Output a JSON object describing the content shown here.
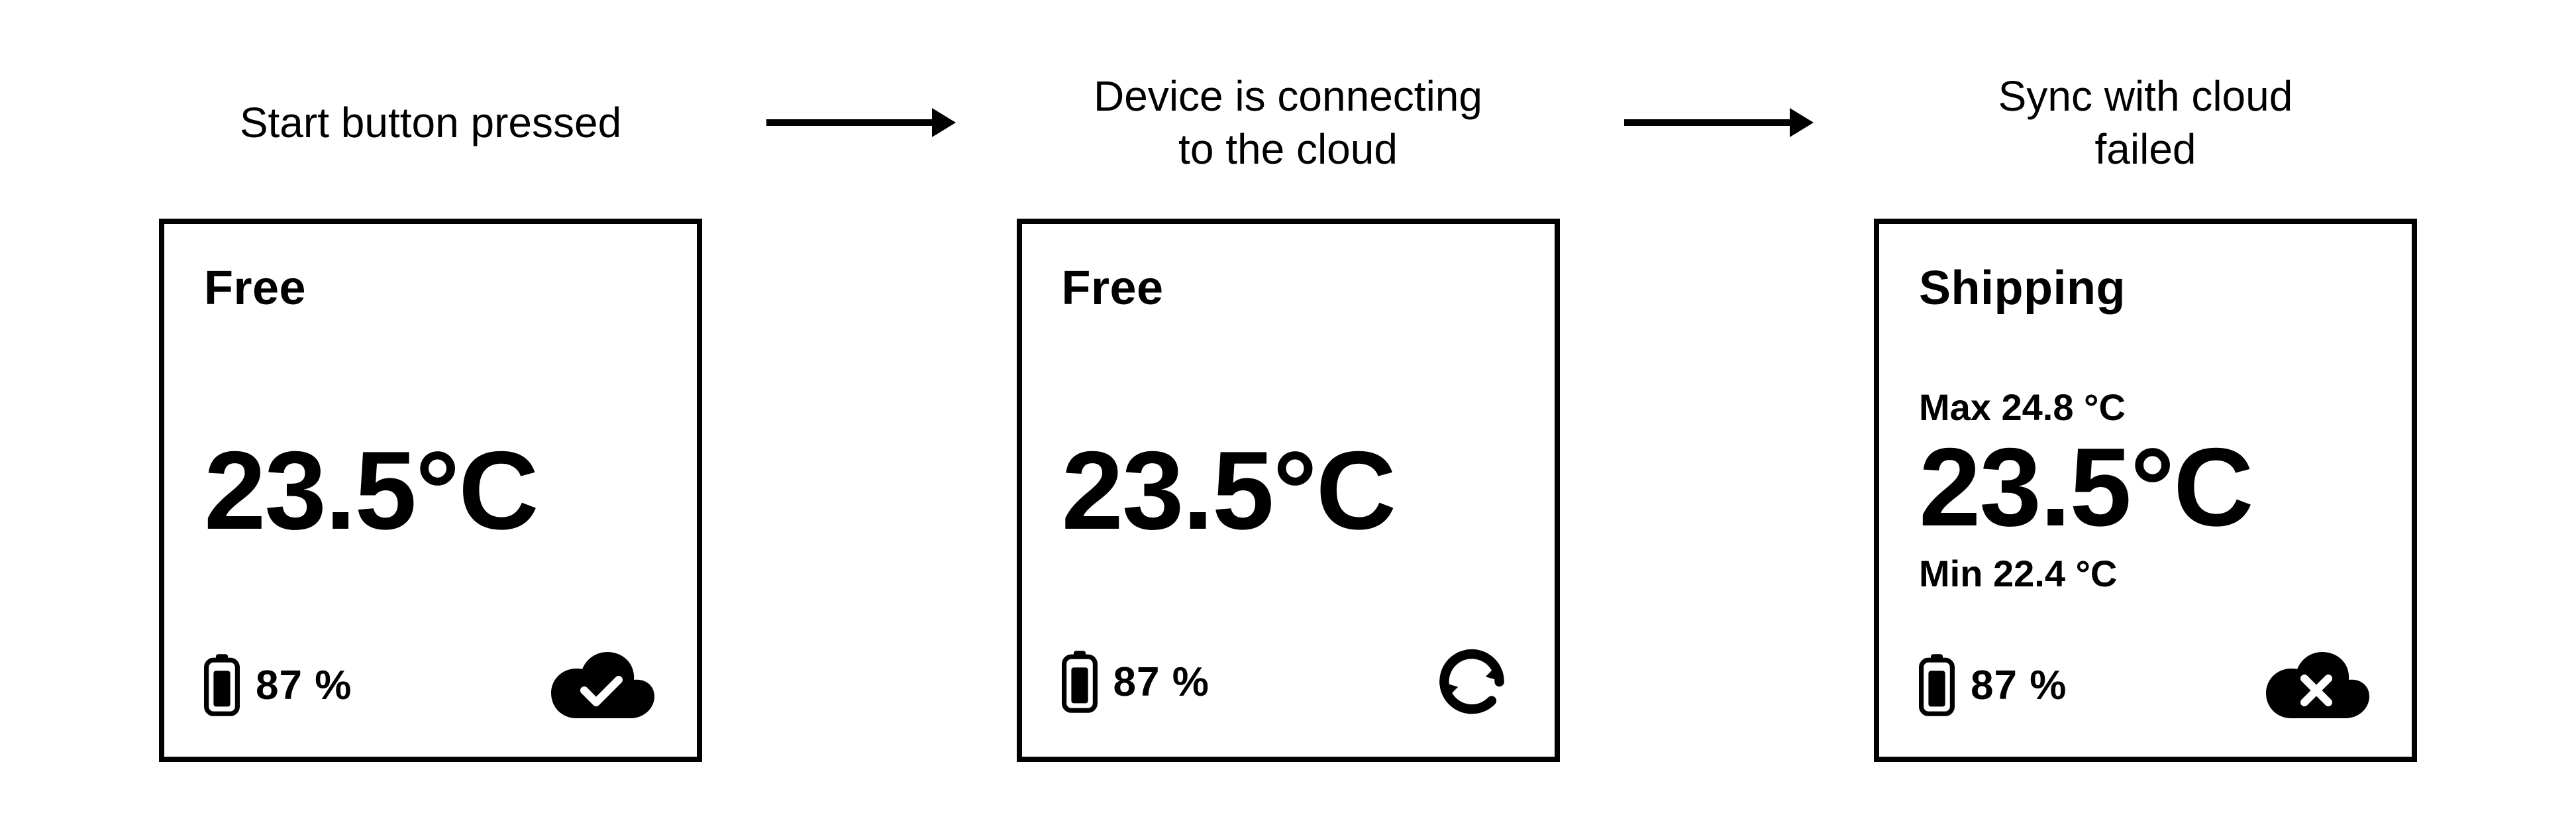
{
  "captions": {
    "step1": "Start button pressed",
    "step2": "Device is connecting\nto the cloud",
    "step3": "Sync with cloud\nfailed"
  },
  "cards": [
    {
      "status": "Free",
      "temperature": "23.5°C",
      "max": null,
      "min": null,
      "battery_percent": "87 %",
      "cloud_icon": "cloud-check"
    },
    {
      "status": "Free",
      "temperature": "23.5°C",
      "max": null,
      "min": null,
      "battery_percent": "87 %",
      "cloud_icon": "sync"
    },
    {
      "status": "Shipping",
      "temperature": "23.5°C",
      "max": "Max 24.8 °C",
      "min": "Min 22.4 °C",
      "battery_percent": "87 %",
      "cloud_icon": "cloud-x"
    }
  ]
}
